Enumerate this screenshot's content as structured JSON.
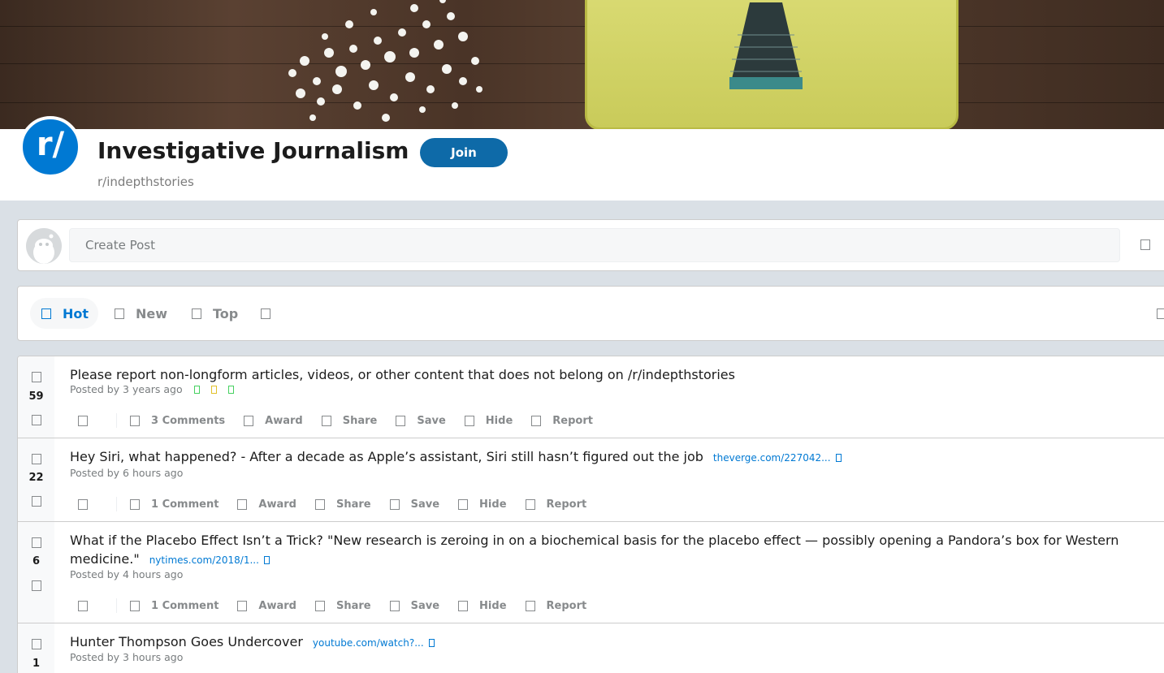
{
  "subreddit": {
    "title": "Investigative Journalism",
    "name": "r/indepthstories",
    "icon_text": "r/",
    "join_label": "Join",
    "accent_color": "#0079d3",
    "join_color": "#0e6aa8"
  },
  "create_post": {
    "placeholder": "Create Post"
  },
  "sort": {
    "tabs": [
      {
        "label": "Hot",
        "active": true
      },
      {
        "label": "New",
        "active": false
      },
      {
        "label": "Top",
        "active": false
      }
    ]
  },
  "posts": [
    {
      "score": "59",
      "title": "Please report non-longform articles, videos, or other content that does not belong on /r/indepthstories",
      "domain": "",
      "meta": "Posted by 3 years ago",
      "comments": "3 Comments"
    },
    {
      "score": "22",
      "title": "Hey Siri, what happened? - After a decade as Apple’s assistant, Siri still hasn’t figured out the job",
      "domain": "theverge.com/227042...",
      "meta": "Posted by 6 hours ago",
      "comments": "1 Comment"
    },
    {
      "score": "6",
      "title": "What if the Placebo Effect Isn’t a Trick? \"New research is zeroing in on a biochemical basis for the placebo effect — possibly opening a Pandora’s box for Western medicine.\"",
      "domain": "nytimes.com/2018/1...",
      "meta": "Posted by 4 hours ago",
      "comments": "1 Comment"
    },
    {
      "score": "1",
      "title": "Hunter Thompson Goes Undercover",
      "domain": "youtube.com/watch?...",
      "meta": "Posted by 3 hours ago"
    }
  ],
  "actions": {
    "award": "Award",
    "share": "Share",
    "save": "Save",
    "hide": "Hide",
    "report": "Report"
  },
  "icons": {
    "subreddit_icon": "reddit-r-slash-icon",
    "awards": [
      "green-award-icon",
      "yellow-award-icon",
      "green-award-icon"
    ]
  }
}
